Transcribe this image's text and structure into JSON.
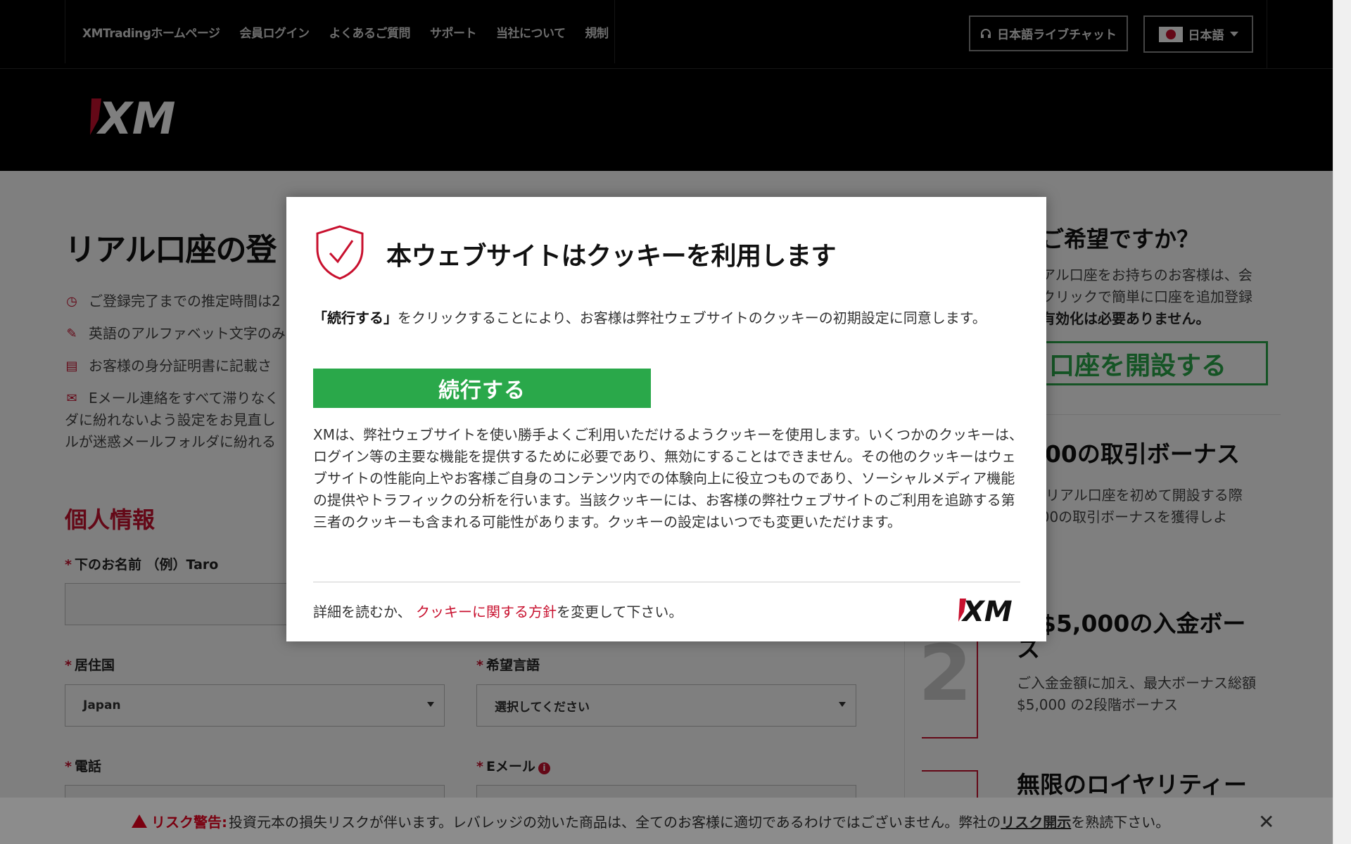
{
  "topnav": {
    "items": [
      "XMTradingホームページ",
      "会員ログイン",
      "よくあるご質問",
      "サポート",
      "当社について",
      "規制"
    ],
    "chat_label": "日本語ライブチャット",
    "lang_label": "日本語"
  },
  "header": {
    "logo_text": "XM"
  },
  "page": {
    "reg_title": "リアル口座の登",
    "bullets": [
      "ご登録完了までの推定時間は2",
      "英語のアルファベット文字のみ",
      "お客様の身分証明書に記載さ",
      "Eメール連絡をすべて滞りなく",
      "ダに紛れないよう設定をお見直し",
      "ルが迷惑メールフォルダに紛れる"
    ],
    "section_title": "個人情報",
    "fields": {
      "first_name_label": "下のお名前 （例）Taro",
      "country_label": "居住国",
      "country_value": "Japan",
      "language_label": "希望言語",
      "language_value": "選択してください",
      "phone_label": "電話",
      "email_label": "Eメール"
    },
    "sidebar": {
      "question": "ご希望ですか？",
      "text_lines": [
        "アル口座をお持ちのお客様は、会",
        "クリックで簡単に口座を追加登録",
        "有効化は必要ありません。"
      ],
      "open_button": "口座を開設する",
      "bonus_title": "000の取引ボーナス",
      "bonus_text": [
        "のリアル口座を初めて開設する際",
        "000の取引ボーナスを獲得しよ"
      ],
      "deposit_title_1": "大$5,000の入金ボー",
      "deposit_title_2": "ス",
      "deposit_text": [
        "ご入金金額に加え、最大ボーナス総額",
        "$5,000 の2段階ボーナス"
      ],
      "step_number": "2",
      "loyalty_title": "無限のロイヤリティー"
    }
  },
  "risk_bar": {
    "warning_label": "リスク警告:",
    "text": "投資元本の損失リスクが伴います。レバレッジの効いた商品は、全てのお客様に適切であるわけではございません。弊社の",
    "link": "リスク開示",
    "suffix": "を熟読下さい。",
    "close": "✕"
  },
  "modal": {
    "title": "本ウェブサイトはクッキーを利用します",
    "intro_bold": "「続行する」",
    "intro_rest": "をクリックすることにより、お客様は弊社ウェブサイトのクッキーの初期設定に同意します。",
    "continue_button": "続行する",
    "body": "XMは、弊社ウェブサイトを使い勝手よくご利用いただけるようクッキーを使用します。いくつかのクッキーは、ログイン等の主要な機能を提供するために必要であり、無効にすることはできません。その他のクッキーはウェブサイトの性能向上やお客様ご自身のコンテンツ内での体験向上に役立つものであり、ソーシャルメディア機能の提供やトラフィックの分析を行います。当該クッキーには、お客様の弊社ウェブサイトのご利用を追跡する第三者のクッキーも含まれる可能性があります。クッキーの設定はいつでも変更いただけます。",
    "footer_prefix": "詳細を読むか、",
    "footer_link": "クッキーに関する方針",
    "footer_suffix": "を変更して下さい。",
    "logo_text": "XM"
  },
  "colors": {
    "brand_red": "#c8102e",
    "accent_green": "#2aa84a"
  }
}
